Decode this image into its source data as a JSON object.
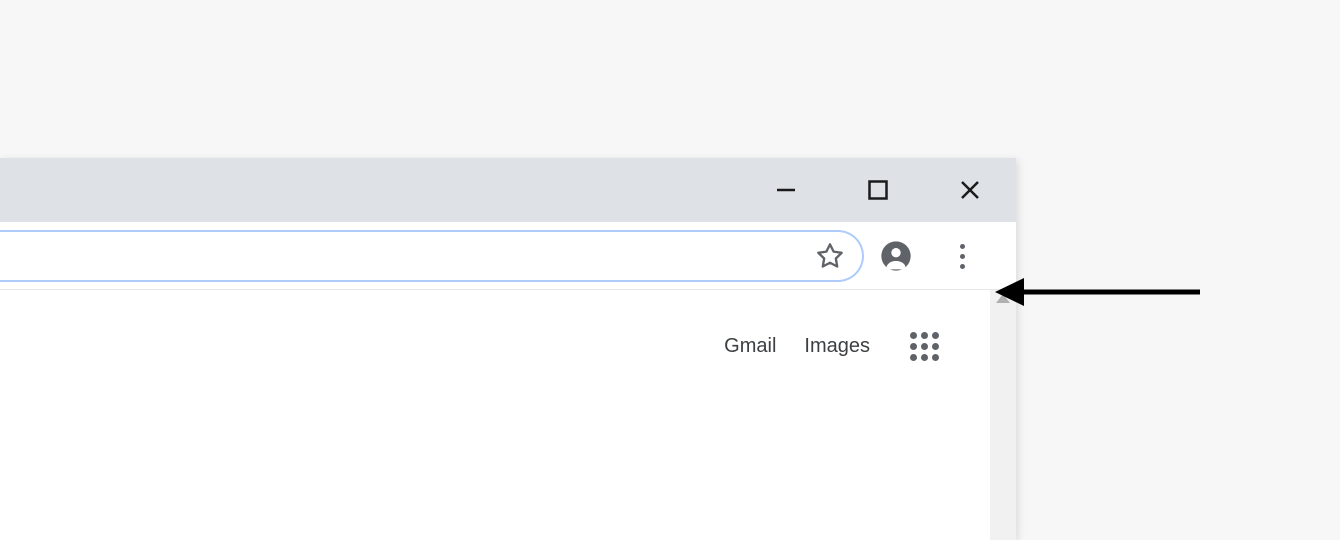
{
  "window": {
    "minimize_label": "Minimize",
    "maximize_label": "Maximize",
    "close_label": "Close"
  },
  "toolbar": {
    "bookmark_label": "Bookmark this tab",
    "profile_label": "You",
    "menu_label": "Customize and control Google Chrome"
  },
  "page": {
    "links": {
      "gmail": "Gmail",
      "images": "Images"
    },
    "apps_label": "Google apps"
  },
  "annotation": {
    "target": "chrome-menu-button"
  }
}
